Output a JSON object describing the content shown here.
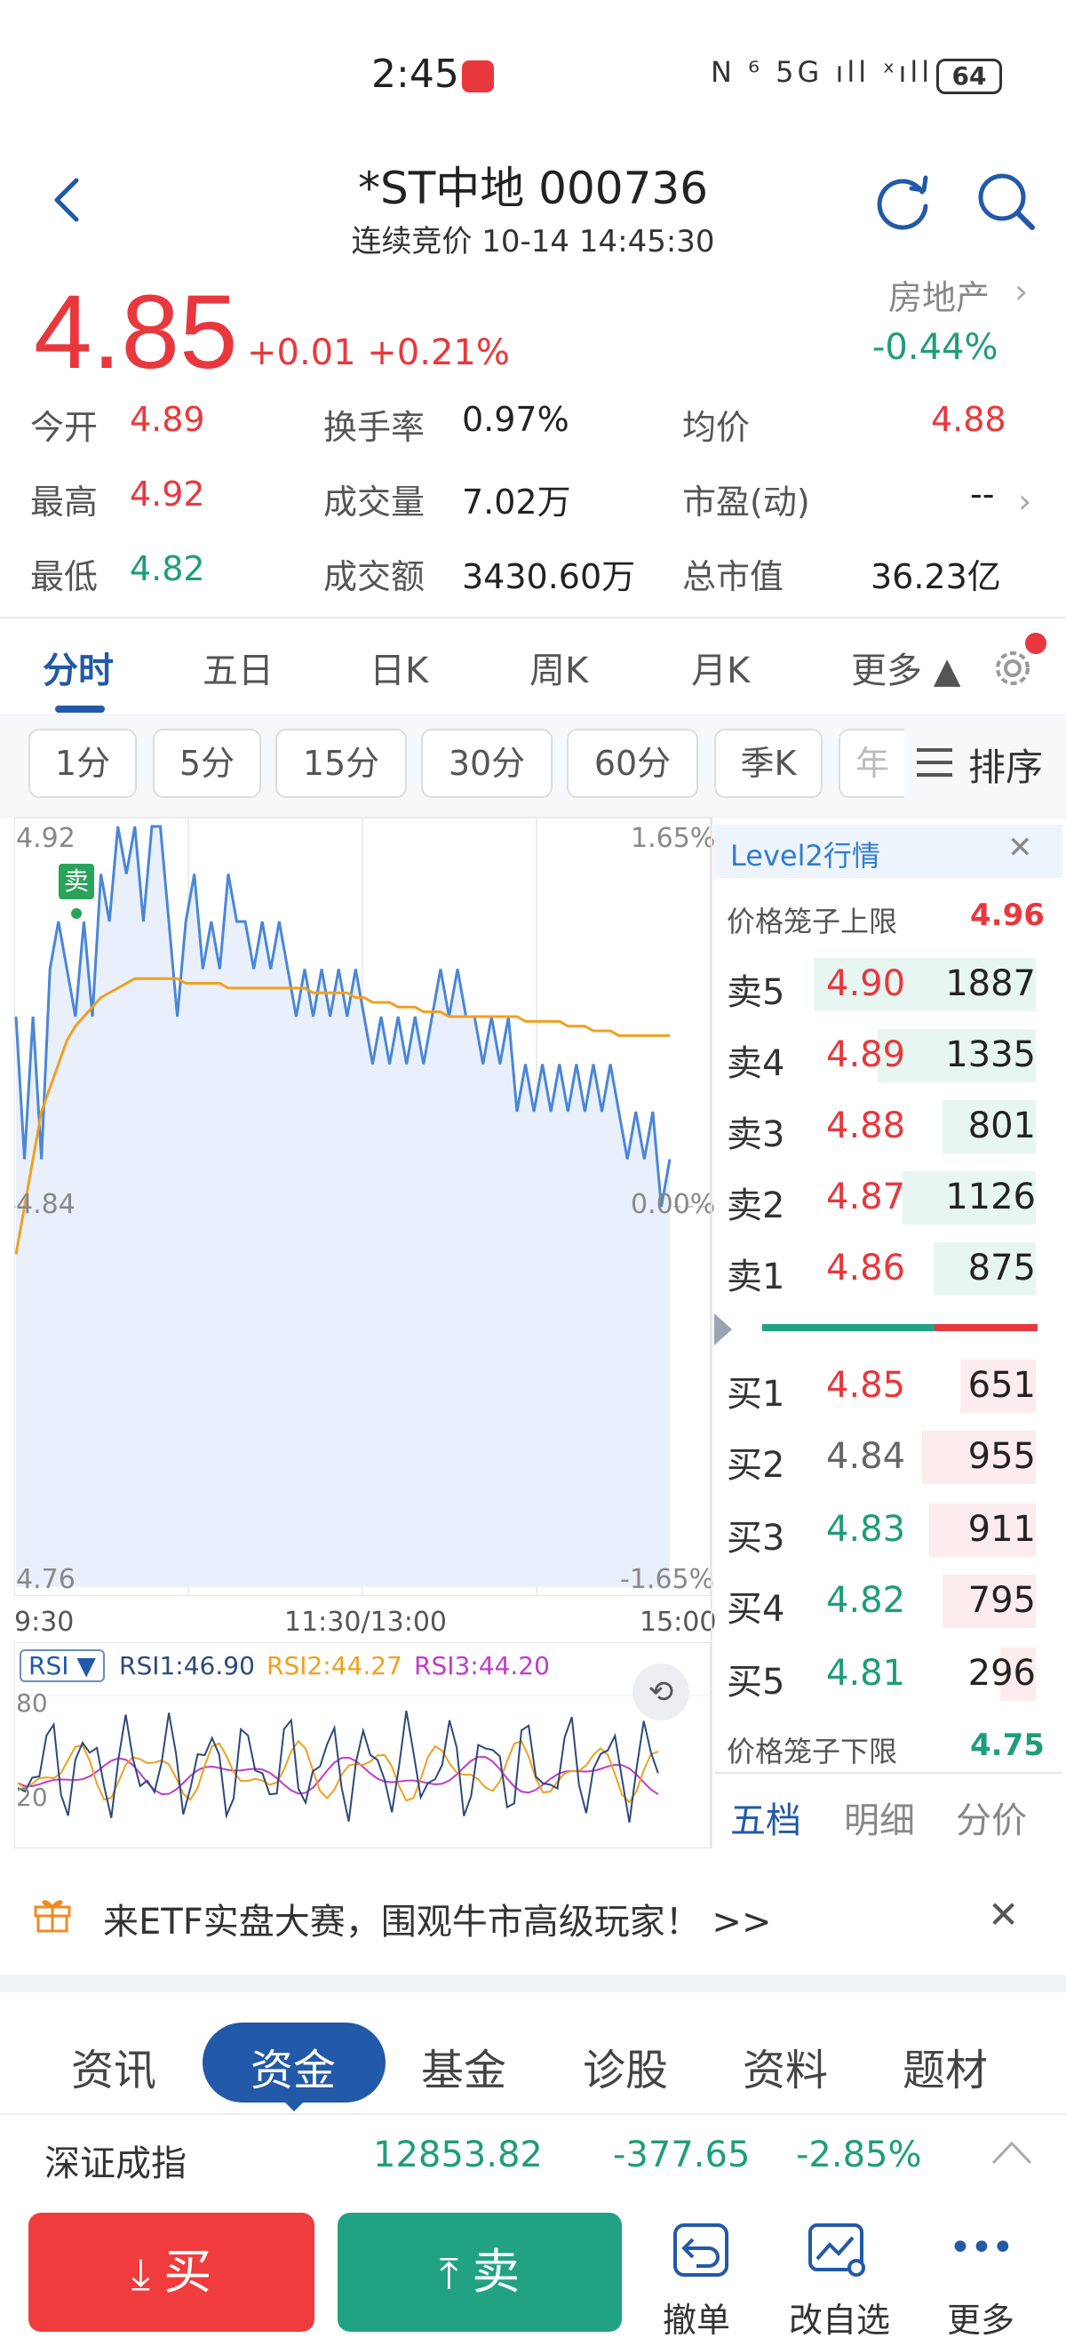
{
  "status_bar": {
    "time": "2:45",
    "icons": "N ⁶ 5G ıll ˣıll",
    "battery": "64"
  },
  "header": {
    "title": "*ST中地 000736",
    "subtitle": "连续竞价 10-14 14:45:30"
  },
  "quote": {
    "price": "4.85",
    "change": "+0.01 +0.21%",
    "sector": "房地产",
    "sector_change": "-0.44%"
  },
  "stats": [
    {
      "label": "今开",
      "value": "4.89",
      "color": "#e8383d"
    },
    {
      "label": "换手率",
      "value": "0.97%",
      "color": "#222222"
    },
    {
      "label": "均价",
      "value": "4.88",
      "color": "#e8383d"
    },
    {
      "label": "最高",
      "value": "4.92",
      "color": "#e8383d"
    },
    {
      "label": "成交量",
      "value": "7.02万",
      "color": "#222222"
    },
    {
      "label": "市盈(动)",
      "value": "--",
      "color": "#222222"
    },
    {
      "label": "最低",
      "value": "4.82",
      "color": "#1f9d7a"
    },
    {
      "label": "成交额",
      "value": "3430.60万",
      "color": "#222222"
    },
    {
      "label": "总市值",
      "value": "36.23亿",
      "color": "#222222"
    }
  ],
  "chart_tabs": [
    "分时",
    "五日",
    "日K",
    "周K",
    "月K",
    "更多 ▲"
  ],
  "period_pills": [
    "1分",
    "5分",
    "15分",
    "30分",
    "60分",
    "季K",
    "年"
  ],
  "sort_label": "排序",
  "chart_data": {
    "type": "line",
    "y_labels_left": [
      "4.92",
      "4.84",
      "4.76"
    ],
    "y_labels_right": [
      "1.65%",
      "0.00%",
      "-1.65%"
    ],
    "x_labels": [
      "9:30",
      "11:30/13:00",
      "15:00"
    ],
    "ylim": [
      4.76,
      4.92
    ],
    "prev_close": 4.84,
    "trade_marker": "卖",
    "series": [
      {
        "values": [
          4.88,
          4.85,
          4.88,
          4.85,
          4.89,
          4.9,
          4.89,
          4.88,
          4.9,
          4.88,
          4.91,
          4.9,
          4.92,
          4.91,
          4.92,
          4.9,
          4.92,
          4.92,
          4.9,
          4.88,
          4.9,
          4.91,
          4.89,
          4.9,
          4.89,
          4.91,
          4.9,
          4.9,
          4.89,
          4.9,
          4.89,
          4.9,
          4.89,
          4.88,
          4.89,
          4.88,
          4.89,
          4.88,
          4.89,
          4.88,
          4.89,
          4.88,
          4.87,
          4.88,
          4.87,
          4.88,
          4.87,
          4.88,
          4.87,
          4.88,
          4.89,
          4.88,
          4.89,
          4.88,
          4.88,
          4.87,
          4.88,
          4.87,
          4.88,
          4.86,
          4.87,
          4.86,
          4.87,
          4.86,
          4.87,
          4.86,
          4.87,
          4.86,
          4.87,
          4.86,
          4.87,
          4.86,
          4.85,
          4.86,
          4.85,
          4.86,
          4.84,
          4.85
        ]
      },
      {
        "values": [
          4.83,
          4.84,
          4.85,
          4.86,
          4.865,
          4.87,
          4.875,
          4.878,
          4.88,
          4.882,
          4.884,
          4.885,
          4.886,
          4.887,
          4.888,
          4.888,
          4.888,
          4.888,
          4.888,
          4.888,
          4.887,
          4.887,
          4.887,
          4.887,
          4.887,
          4.886,
          4.886,
          4.886,
          4.886,
          4.886,
          4.886,
          4.886,
          4.886,
          4.886,
          4.886,
          4.885,
          4.885,
          4.885,
          4.885,
          4.885,
          4.884,
          4.884,
          4.883,
          4.883,
          4.883,
          4.882,
          4.882,
          4.882,
          4.881,
          4.881,
          4.881,
          4.88,
          4.88,
          4.88,
          4.88,
          4.88,
          4.88,
          4.88,
          4.88,
          4.88,
          4.879,
          4.879,
          4.879,
          4.879,
          4.879,
          4.878,
          4.878,
          4.878,
          4.877,
          4.877,
          4.877,
          4.876,
          4.876,
          4.876,
          4.876,
          4.876,
          4.876,
          4.876
        ]
      }
    ],
    "colors": {
      "price": "#4a86d8",
      "avg": "#f0a020",
      "fill": "#e9f0fb"
    }
  },
  "rsi": {
    "label": "RSI ▼",
    "rsi1": "RSI1:46.90",
    "rsi2": "RSI2:44.27",
    "rsi3": "RSI3:44.20",
    "level_high": "80",
    "level_low": "20",
    "colors": {
      "rsi1": "#2c4a7a",
      "rsi2": "#f0a020",
      "rsi3": "#c03cc8"
    }
  },
  "level2": {
    "title": "Level2行情",
    "limit_up_label": "价格笼子上限",
    "limit_up": "4.96",
    "limit_down_label": "价格笼子下限",
    "limit_down": "4.75",
    "asks": [
      {
        "label": "卖5",
        "price": "4.90",
        "volume": "1887",
        "frac": 1.0,
        "color": "#e8383d"
      },
      {
        "label": "卖4",
        "price": "4.89",
        "volume": "1335",
        "frac": 0.71,
        "color": "#e8383d"
      },
      {
        "label": "卖3",
        "price": "4.88",
        "volume": "801",
        "frac": 0.42,
        "color": "#e8383d"
      },
      {
        "label": "卖2",
        "price": "4.87",
        "volume": "1126",
        "frac": 0.6,
        "color": "#e8383d"
      },
      {
        "label": "卖1",
        "price": "4.86",
        "volume": "875",
        "frac": 0.46,
        "color": "#e8383d"
      }
    ],
    "bids": [
      {
        "label": "买1",
        "price": "4.85",
        "volume": "651",
        "frac": 0.34,
        "color": "#e8383d"
      },
      {
        "label": "买2",
        "price": "4.84",
        "volume": "955",
        "frac": 0.51,
        "color": "#666666"
      },
      {
        "label": "买3",
        "price": "4.83",
        "volume": "911",
        "frac": 0.48,
        "color": "#1f9d7a"
      },
      {
        "label": "买4",
        "price": "4.82",
        "volume": "795",
        "frac": 0.42,
        "color": "#1f9d7a"
      },
      {
        "label": "买5",
        "price": "4.81",
        "volume": "296",
        "frac": 0.16,
        "color": "#1f9d7a"
      }
    ],
    "tabs": [
      "五档",
      "明细",
      "分价"
    ]
  },
  "banner": {
    "text": "来ETF实盘大赛，围观牛市高级玩家！ >>",
    "close": "✕"
  },
  "info_tabs": [
    "资讯",
    "资金",
    "基金",
    "诊股",
    "资料",
    "题材"
  ],
  "index": {
    "name": "深证成指",
    "value": "12853.82",
    "change": "-377.65",
    "pct": "-2.85%"
  },
  "actions": {
    "buy": "买",
    "sell": "卖",
    "cancel": "撤单",
    "watchlist": "改自选",
    "more": "更多"
  }
}
